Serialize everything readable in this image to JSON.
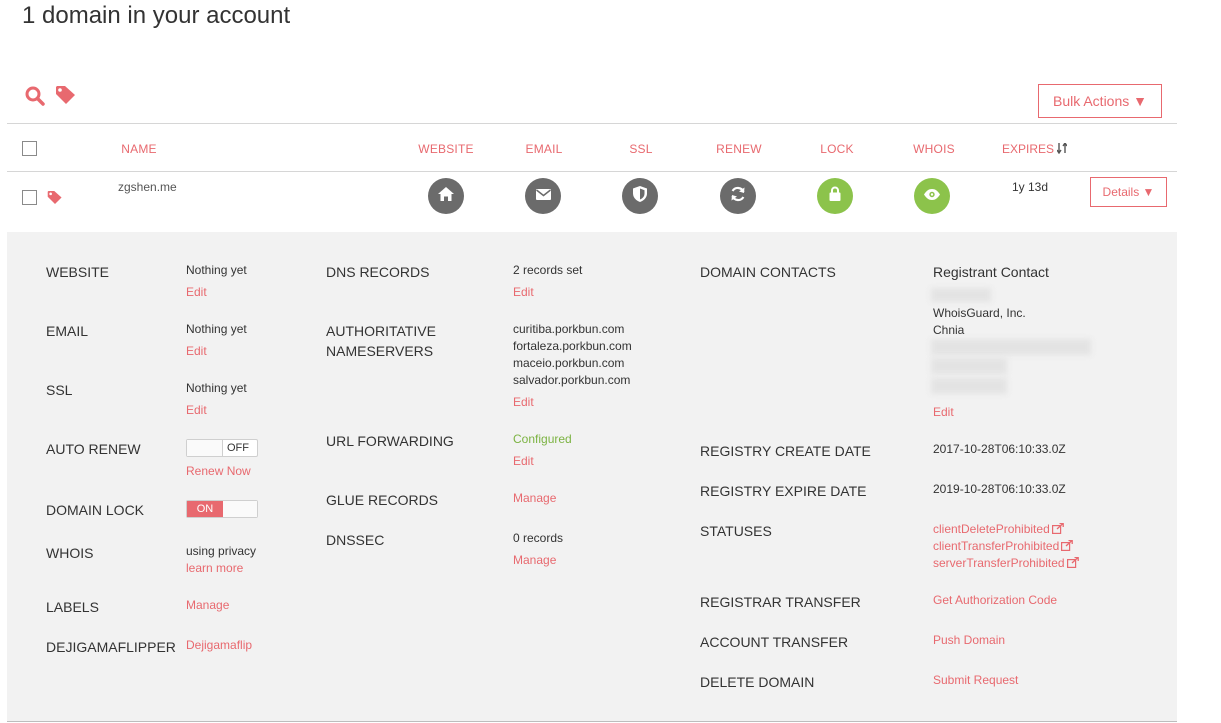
{
  "page_title": "1 domain in your account",
  "toolbar": {
    "bulk_label": "Bulk Actions ▼"
  },
  "columns": {
    "name": "NAME",
    "website": "WEBSITE",
    "email": "EMAIL",
    "ssl": "SSL",
    "renew": "RENEW",
    "lock": "LOCK",
    "whois": "WHOIS",
    "expires": "EXPIRES"
  },
  "domain": {
    "name": "zgshen.me",
    "expires": "1y 13d",
    "details_label": "Details ▼"
  },
  "details": {
    "website": {
      "label": "WEBSITE",
      "value": "Nothing yet",
      "action": "Edit"
    },
    "email": {
      "label": "EMAIL",
      "value": "Nothing yet",
      "action": "Edit"
    },
    "ssl": {
      "label": "SSL",
      "value": "Nothing yet",
      "action": "Edit"
    },
    "auto_renew": {
      "label": "AUTO RENEW",
      "toggle": "OFF",
      "action": "Renew Now"
    },
    "domain_lock": {
      "label": "DOMAIN LOCK",
      "toggle": "ON"
    },
    "whois": {
      "label": "WHOIS",
      "value": "using privacy",
      "action": "learn more"
    },
    "labels": {
      "label": "LABELS",
      "action": "Manage"
    },
    "dejiga": {
      "label": "DEJIGAMAFLIPPER",
      "action": "Dejigamaflip"
    },
    "dns_records": {
      "label": "DNS RECORDS",
      "value": "2 records set",
      "action": "Edit"
    },
    "nameservers": {
      "label_line1": "AUTHORITATIVE",
      "label_line2": "NAMESERVERS",
      "values": [
        "curitiba.porkbun.com",
        "fortaleza.porkbun.com",
        "maceio.porkbun.com",
        "salvador.porkbun.com"
      ],
      "action": "Edit"
    },
    "url_forwarding": {
      "label": "URL FORWARDING",
      "value": "Configured",
      "action": "Edit"
    },
    "glue_records": {
      "label": "GLUE RECORDS",
      "action": "Manage"
    },
    "dnssec": {
      "label": "DNSSEC",
      "value": "0 records",
      "action": "Manage"
    },
    "domain_contacts": {
      "label": "DOMAIN CONTACTS",
      "heading": "Registrant Contact",
      "org": "WhoisGuard, Inc.",
      "country": "Chnia",
      "action": "Edit"
    },
    "create_date": {
      "label": "REGISTRY CREATE DATE",
      "value": "2017-10-28T06:10:33.0Z"
    },
    "expire_date": {
      "label": "REGISTRY EXPIRE DATE",
      "value": "2019-10-28T06:10:33.0Z"
    },
    "statuses": {
      "label": "STATUSES",
      "values": [
        "clientDeleteProhibited",
        "clientTransferProhibited",
        "serverTransferProhibited"
      ]
    },
    "registrar_transfer": {
      "label": "REGISTRAR TRANSFER",
      "action": "Get Authorization Code"
    },
    "account_transfer": {
      "label": "ACCOUNT TRANSFER",
      "action": "Push Domain"
    },
    "delete_domain": {
      "label": "DELETE DOMAIN",
      "action": "Submit Request"
    }
  },
  "colors": {
    "accent": "#e8696f",
    "icon_dark": "#6b6b6b",
    "icon_green": "#8cc34b",
    "configured_green": "#7cb342",
    "panel_bg": "#f2f2f2"
  },
  "icons": [
    "search-icon",
    "tag-icon",
    "sort-icon",
    "home-icon",
    "envelope-icon",
    "shield-icon",
    "refresh-icon",
    "lock-icon",
    "eye-icon",
    "external-link-icon"
  ]
}
